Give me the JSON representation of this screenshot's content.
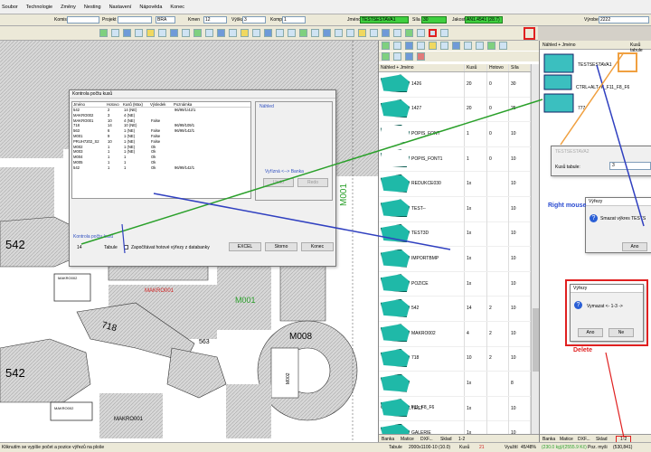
{
  "menu": [
    "Soubor",
    "Technologie",
    "Změny",
    "Nesting",
    "Nastavení",
    "Nápověda",
    "Konec"
  ],
  "props": {
    "komis": "Komis",
    "projekt": "Projekt",
    "kmen_lbl": "Kmen",
    "kmen": "12",
    "vyska_lbl": "Výška",
    "vyska": "3",
    "komp_lbl": "Komp",
    "komp": "1",
    "jmeno_lbl": "Jméno",
    "jmeno": "TESTSESTAVA1",
    "sila_lbl": "Síla",
    "sila": "30",
    "jakost_lbl": "Jakost",
    "jakost": "AN1.4541 (28.7)",
    "vyrobek_lbl": "Výrobek",
    "vyrobek": "2222",
    "tool_sel": "BRA"
  },
  "canvas_labels": {
    "a542_1": "542",
    "a542_2": "542",
    "makro1": "MAKRO001",
    "makro_small": "MAKRO002",
    "m001": "M001",
    "m008": "M008",
    "v718": "718",
    "v563": "563",
    "m002": "M002",
    "m001b": "M001",
    "makro2": "MAKRO001",
    "makro_small2": "MAKRO002"
  },
  "kontrola": {
    "title": "Kontrola počtu kusů",
    "headers": [
      "Jméno",
      "Hotovo",
      "Kusů (Max)",
      "Výsledek",
      "Poznámka"
    ],
    "rows": [
      [
        "542",
        "2",
        "14 (NE)",
        "",
        "96/99/1/42/1"
      ],
      [
        "MAKRO002",
        "3",
        "4 (NE)",
        "",
        ""
      ],
      [
        "MAKRO001",
        "10",
        "4 (NE)",
        "False",
        ""
      ],
      [
        "718",
        "14",
        "10 (NE)",
        "",
        "96/99/109/1"
      ],
      [
        "563",
        "6",
        "1 (NE)",
        "False",
        "96/99/142/1"
      ],
      [
        "M001",
        "9",
        "1 (NE)",
        "False",
        ""
      ],
      [
        "PRUH7202_S2",
        "10",
        "1 (NE)",
        "False",
        ""
      ],
      [
        "M002",
        "1",
        "1 (NE)",
        "Ok",
        ""
      ],
      [
        "M003",
        "1",
        "1 (NE)",
        "Ok",
        ""
      ],
      [
        "M004",
        "1",
        "1",
        "Ok",
        ""
      ],
      [
        "M005",
        "1",
        "1",
        "Ok",
        ""
      ],
      [
        "542",
        "1",
        "1",
        "Ok",
        "96/99/142/1"
      ]
    ],
    "nahled": "Náhled",
    "vyriznuti": "Vyřízná <--> Banka",
    "undo": "Undo",
    "redo": "Redo",
    "kontrola_lbl": "Kontrola počtu kusů",
    "tabule_lbl": "Tabule",
    "tabule": "14",
    "checkbox_lbl": "Započítávat hotové výřezy z databanky",
    "excel": "EXCEL",
    "storno": "Storno",
    "konec": "Konec"
  },
  "parts": {
    "headers": [
      "Náhled + Jméno",
      "Kusů",
      "Hotovo",
      "Síla"
    ],
    "rows": [
      [
        "1426",
        "20",
        "0",
        "30"
      ],
      [
        "1427",
        "20",
        "0",
        "25"
      ],
      [
        "POPIS_FONT",
        "1",
        "0",
        "10"
      ],
      [
        "POPIS_FONT1",
        "1",
        "0",
        "10"
      ],
      [
        "REDUKCE030",
        "1x",
        "",
        "10"
      ],
      [
        "TEST--",
        "1x",
        "",
        "10"
      ],
      [
        "TEST3D",
        "1x",
        "",
        "10"
      ],
      [
        "IMPORTBMP",
        "1x",
        "",
        "10"
      ],
      [
        "POZICE",
        "1x",
        "",
        "10"
      ],
      [
        "542",
        "14",
        "2",
        "10"
      ],
      [
        "MAKRO002",
        "4",
        "2",
        "10"
      ],
      [
        "718",
        "10",
        "2",
        "10"
      ],
      [
        "CTRL+ALT+K_F11_F8_F6",
        "1x",
        "",
        "8"
      ],
      [
        "TEST",
        "1x",
        "",
        "10"
      ],
      [
        "GALERIE",
        "1x",
        "",
        "10"
      ]
    ]
  },
  "mtabs": [
    "Banka",
    "Matice",
    "DXF...",
    "Sklad",
    "1-2"
  ],
  "right": {
    "header": "Náhled + Jméno",
    "header2": "Kusů tabule",
    "item1": "TESTSESTAVA1",
    "item2": "CTRL+ALT+K_F11_F8_F6",
    "item3": "777",
    "sub_title": "TESTSESTAVA2",
    "kusu_lbl": "Kusů tabule:",
    "kusu": "3",
    "tabs": [
      "Banka",
      "Matice",
      "DXF...",
      "Sklad",
      "1-2"
    ]
  },
  "dlg1": {
    "title": "Výřezy",
    "text": "Smazat výkres TESTS",
    "ano": "Ano"
  },
  "dlg2": {
    "title": "Výřezy",
    "text": "Vymazat <- 1-3 ->",
    "ano": "Ano",
    "ne": "Ne"
  },
  "ann": {
    "right_mouse": "Right mouse",
    "delete": "Delete"
  },
  "status": {
    "hint": "Kliknutím se vypíše počet a pozice výřezů na ploše",
    "tabule_lbl": "Tabule",
    "tabule": "2000x1100-10 (10.0)",
    "kusu_lbl": "Kusů",
    "kusu": "21",
    "vyuziti_lbl": "Využití",
    "vyuziti": "45/48%",
    "hmot": "(230.0 kg)/(2555.9 Kč)",
    "poz_lbl": "Poz. myši",
    "poz": "(530,841)"
  }
}
